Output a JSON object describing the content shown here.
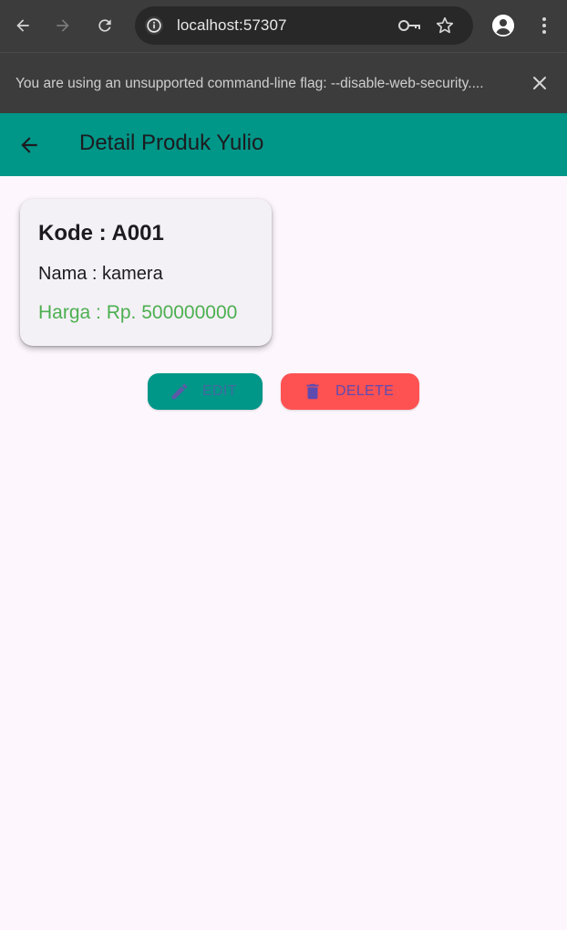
{
  "browser": {
    "url": "localhost:57307",
    "infobar_message": "You are using an unsupported command-line flag: --disable-web-security....",
    "icons": {
      "back": "arrow-left-icon",
      "forward": "arrow-right-icon",
      "reload": "reload-icon",
      "site_info": "info-icon",
      "password": "key-icon",
      "bookmark": "star-icon",
      "profile": "person-icon",
      "menu": "kebab-menu-icon",
      "close": "close-icon"
    }
  },
  "appbar": {
    "title": "Detail Produk Yulio",
    "back_icon": "arrow-back-icon",
    "color": "#009688"
  },
  "product": {
    "kode": "Kode : A001",
    "nama": "Nama : kamera",
    "harga": "Harga : Rp. 500000000",
    "harga_color": "#4caf50"
  },
  "actions": {
    "edit_label": "EDIT",
    "edit_icon": "pencil-icon",
    "edit_color": "#009688",
    "delete_label": "DELETE",
    "delete_icon": "trash-icon",
    "delete_color": "#fe5252"
  }
}
